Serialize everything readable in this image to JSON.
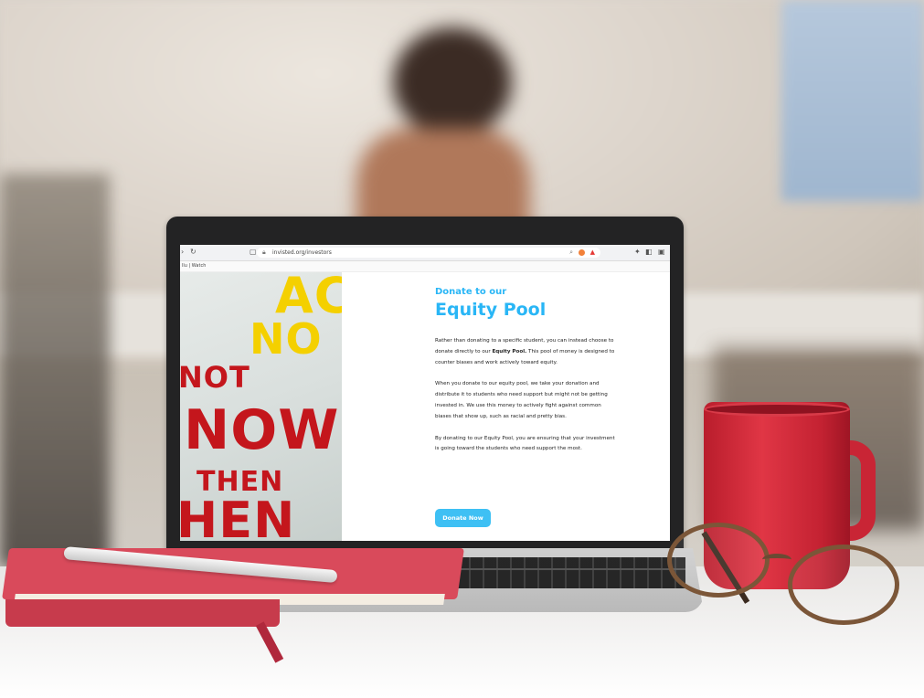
{
  "browser": {
    "url": "invisted.org/investors",
    "bookmarks_text": "llu | Watch"
  },
  "page": {
    "kicker": "Donate to our",
    "headline": "Equity Pool",
    "para1_a": "Rather than donating to a specific student, you can instead choose to donate directly to our ",
    "para1_bold": "Equity Pool.",
    "para1_b": " This pool of money is designed to counter biases and work actively toward equity.",
    "para2": "When you donate to our equity pool, we take your donation and distribute it to students who need support but might not be getting invested in. We use this money to actively fight against common biases that show up, such as racial and pretty bias.",
    "para3": "By donating to our Equity Pool, you are ensuring that your investment is going toward the students who need support the most.",
    "button": "Donate Now"
  },
  "graffiti": {
    "line1": "AC",
    "line2": "NO",
    "line3": "NOT",
    "line4": "NOW",
    "line5": "THEN",
    "line6": "HEN"
  },
  "colors": {
    "accent": "#29b6f6",
    "button": "#3ec0f4",
    "graffiti_red": "#c4161c",
    "graffiti_yellow": "#f4d000"
  },
  "icons": [
    "back-icon",
    "reload-icon",
    "bookmark-icon",
    "lock-icon",
    "zoom-icon",
    "extension-icon",
    "warning-icon",
    "puzzle-icon",
    "sidepanel-icon",
    "window-icon"
  ]
}
